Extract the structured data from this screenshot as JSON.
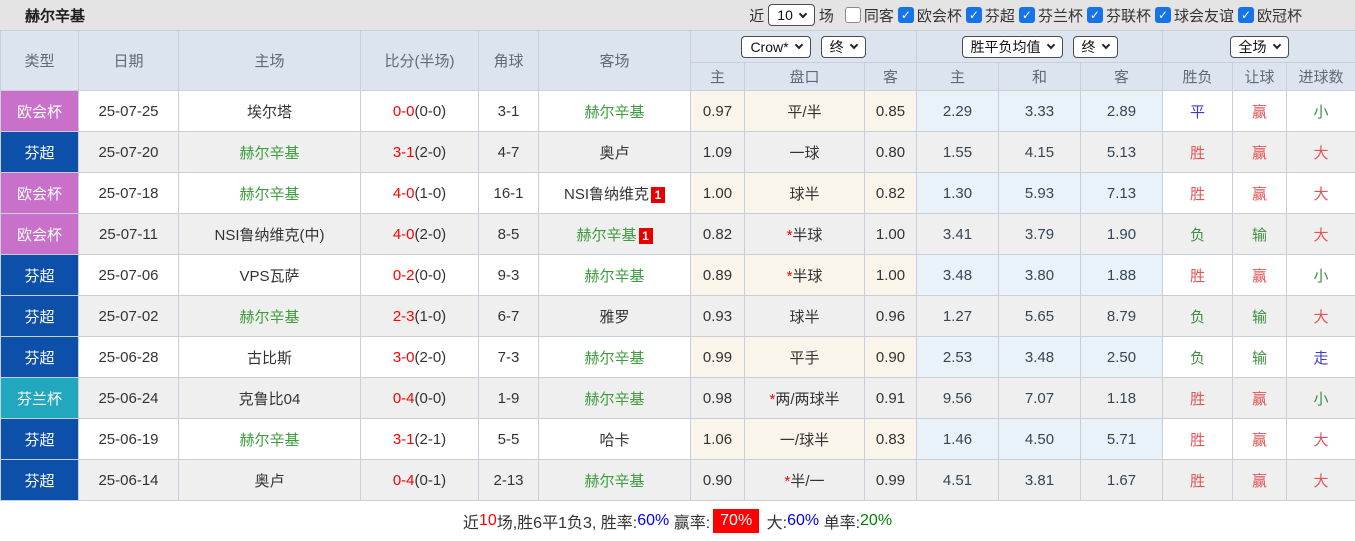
{
  "title": "赫尔辛基",
  "toolbar": {
    "recent_prefix": "近",
    "recent_value": "10",
    "recent_suffix": "场",
    "filters": [
      {
        "label": "同客",
        "checked": false
      },
      {
        "label": "欧会杯",
        "checked": true
      },
      {
        "label": "芬超",
        "checked": true
      },
      {
        "label": "芬兰杯",
        "checked": true
      },
      {
        "label": "芬联杯",
        "checked": true
      },
      {
        "label": "球会友谊",
        "checked": true
      },
      {
        "label": "欧冠杯",
        "checked": true
      }
    ]
  },
  "table": {
    "main_headers": [
      "类型",
      "日期",
      "主场",
      "比分(半场)",
      "角球",
      "客场"
    ],
    "odds_group": {
      "bookmaker_select": "Crow*",
      "time_select": "终",
      "sub_headers": [
        "主",
        "盘口",
        "客"
      ]
    },
    "avg_group": {
      "label_select": "胜平负均值",
      "time_select": "终",
      "sub_headers": [
        "主",
        "和",
        "客"
      ]
    },
    "result_group": {
      "scope_select": "全场",
      "sub_headers": [
        "胜负",
        "让球",
        "进球数"
      ]
    },
    "rows": [
      {
        "type": "欧会杯",
        "date": "25-07-25",
        "home": {
          "name": "埃尔塔",
          "highlight": false
        },
        "score": "0-0",
        "half": "(0-0)",
        "corner": "3-1",
        "away": {
          "name": "赫尔辛基",
          "highlight": true
        },
        "odds": {
          "home": "0.97",
          "star": false,
          "handicap": "平/半",
          "away": "0.85"
        },
        "avg": {
          "home": "2.29",
          "draw": "3.33",
          "away": "2.89"
        },
        "result": {
          "outcome": {
            "text": "平",
            "color": "blue"
          },
          "handicap": {
            "text": "赢",
            "color": "red"
          },
          "goals": {
            "text": "小",
            "color": "green"
          }
        }
      },
      {
        "type": "芬超",
        "date": "25-07-20",
        "home": {
          "name": "赫尔辛基",
          "highlight": true
        },
        "score": "3-1",
        "half": "(2-0)",
        "corner": "4-7",
        "away": {
          "name": "奥卢",
          "highlight": false
        },
        "odds": {
          "home": "1.09",
          "star": false,
          "handicap": "一球",
          "away": "0.80"
        },
        "avg": {
          "home": "1.55",
          "draw": "4.15",
          "away": "5.13"
        },
        "result": {
          "outcome": {
            "text": "胜",
            "color": "red"
          },
          "handicap": {
            "text": "赢",
            "color": "red"
          },
          "goals": {
            "text": "大",
            "color": "red"
          }
        }
      },
      {
        "type": "欧会杯",
        "date": "25-07-18",
        "home": {
          "name": "赫尔辛基",
          "highlight": true
        },
        "score": "4-0",
        "half": "(1-0)",
        "corner": "16-1",
        "away": {
          "name": "NSI鲁纳维克",
          "highlight": false,
          "badge": "1"
        },
        "odds": {
          "home": "1.00",
          "star": false,
          "handicap": "球半",
          "away": "0.82"
        },
        "avg": {
          "home": "1.30",
          "draw": "5.93",
          "away": "7.13"
        },
        "result": {
          "outcome": {
            "text": "胜",
            "color": "red"
          },
          "handicap": {
            "text": "赢",
            "color": "red"
          },
          "goals": {
            "text": "大",
            "color": "red"
          }
        }
      },
      {
        "type": "欧会杯",
        "date": "25-07-11",
        "home": {
          "name": "NSI鲁纳维克(中)",
          "highlight": false
        },
        "score": "4-0",
        "half": "(2-0)",
        "corner": "8-5",
        "away": {
          "name": "赫尔辛基",
          "highlight": true,
          "badge": "1"
        },
        "odds": {
          "home": "0.82",
          "star": true,
          "handicap": "半球",
          "away": "1.00"
        },
        "avg": {
          "home": "3.41",
          "draw": "3.79",
          "away": "1.90"
        },
        "result": {
          "outcome": {
            "text": "负",
            "color": "green"
          },
          "handicap": {
            "text": "输",
            "color": "green"
          },
          "goals": {
            "text": "大",
            "color": "red"
          }
        }
      },
      {
        "type": "芬超",
        "date": "25-07-06",
        "home": {
          "name": "VPS瓦萨",
          "highlight": false
        },
        "score": "0-2",
        "half": "(0-0)",
        "corner": "9-3",
        "away": {
          "name": "赫尔辛基",
          "highlight": true
        },
        "odds": {
          "home": "0.89",
          "star": true,
          "handicap": "半球",
          "away": "1.00"
        },
        "avg": {
          "home": "3.48",
          "draw": "3.80",
          "away": "1.88"
        },
        "result": {
          "outcome": {
            "text": "胜",
            "color": "red"
          },
          "handicap": {
            "text": "赢",
            "color": "red"
          },
          "goals": {
            "text": "小",
            "color": "green"
          }
        }
      },
      {
        "type": "芬超",
        "date": "25-07-02",
        "home": {
          "name": "赫尔辛基",
          "highlight": true
        },
        "score": "2-3",
        "half": "(1-0)",
        "corner": "6-7",
        "away": {
          "name": "雅罗",
          "highlight": false
        },
        "odds": {
          "home": "0.93",
          "star": false,
          "handicap": "球半",
          "away": "0.96"
        },
        "avg": {
          "home": "1.27",
          "draw": "5.65",
          "away": "8.79"
        },
        "result": {
          "outcome": {
            "text": "负",
            "color": "green"
          },
          "handicap": {
            "text": "输",
            "color": "green"
          },
          "goals": {
            "text": "大",
            "color": "red"
          }
        }
      },
      {
        "type": "芬超",
        "date": "25-06-28",
        "home": {
          "name": "古比斯",
          "highlight": false
        },
        "score": "3-0",
        "half": "(2-0)",
        "corner": "7-3",
        "away": {
          "name": "赫尔辛基",
          "highlight": true
        },
        "odds": {
          "home": "0.99",
          "star": false,
          "handicap": "平手",
          "away": "0.90"
        },
        "avg": {
          "home": "2.53",
          "draw": "3.48",
          "away": "2.50"
        },
        "result": {
          "outcome": {
            "text": "负",
            "color": "green"
          },
          "handicap": {
            "text": "输",
            "color": "green"
          },
          "goals": {
            "text": "走",
            "color": "blue"
          }
        }
      },
      {
        "type": "芬兰杯",
        "date": "25-06-24",
        "home": {
          "name": "克鲁比04",
          "highlight": false
        },
        "score": "0-4",
        "half": "(0-0)",
        "corner": "1-9",
        "away": {
          "name": "赫尔辛基",
          "highlight": true
        },
        "odds": {
          "home": "0.98",
          "star": true,
          "handicap": "两/两球半",
          "away": "0.91"
        },
        "avg": {
          "home": "9.56",
          "draw": "7.07",
          "away": "1.18"
        },
        "result": {
          "outcome": {
            "text": "胜",
            "color": "red"
          },
          "handicap": {
            "text": "赢",
            "color": "red"
          },
          "goals": {
            "text": "小",
            "color": "green"
          }
        }
      },
      {
        "type": "芬超",
        "date": "25-06-19",
        "home": {
          "name": "赫尔辛基",
          "highlight": true
        },
        "score": "3-1",
        "half": "(2-1)",
        "corner": "5-5",
        "away": {
          "name": "哈卡",
          "highlight": false
        },
        "odds": {
          "home": "1.06",
          "star": false,
          "handicap": "一/球半",
          "away": "0.83"
        },
        "avg": {
          "home": "1.46",
          "draw": "4.50",
          "away": "5.71"
        },
        "result": {
          "outcome": {
            "text": "胜",
            "color": "red"
          },
          "handicap": {
            "text": "赢",
            "color": "red"
          },
          "goals": {
            "text": "大",
            "color": "red"
          }
        }
      },
      {
        "type": "芬超",
        "date": "25-06-14",
        "home": {
          "name": "奥卢",
          "highlight": false
        },
        "score": "0-4",
        "half": "(0-1)",
        "corner": "2-13",
        "away": {
          "name": "赫尔辛基",
          "highlight": true
        },
        "odds": {
          "home": "0.90",
          "star": true,
          "handicap": "半/一",
          "away": "0.99"
        },
        "avg": {
          "home": "4.51",
          "draw": "3.81",
          "away": "1.67"
        },
        "result": {
          "outcome": {
            "text": "胜",
            "color": "red"
          },
          "handicap": {
            "text": "赢",
            "color": "red"
          },
          "goals": {
            "text": "大",
            "color": "red"
          }
        }
      }
    ]
  },
  "footer": {
    "segments": [
      {
        "text": "近",
        "style": "plain"
      },
      {
        "text": "10",
        "style": "red"
      },
      {
        "text": "场,胜6平1负3, 胜率:",
        "style": "plain"
      },
      {
        "text": "60%",
        "style": "blue"
      },
      {
        "text": " 赢率:",
        "style": "plain"
      },
      {
        "text": "70%",
        "style": "red-badge"
      },
      {
        "text": " 大:",
        "style": "plain"
      },
      {
        "text": "60%",
        "style": "blue"
      },
      {
        "text": " 单率:",
        "style": "plain"
      },
      {
        "text": "20%",
        "style": "green"
      }
    ]
  },
  "colors": {
    "league": {
      "欧会杯": "#C970CB",
      "芬超": "#0C50AA",
      "芬兰杯": "#22A8BE"
    },
    "accent_red": "#FF0000",
    "team_green": "#3D9C3D",
    "checkbox_blue": "#1673E8"
  }
}
